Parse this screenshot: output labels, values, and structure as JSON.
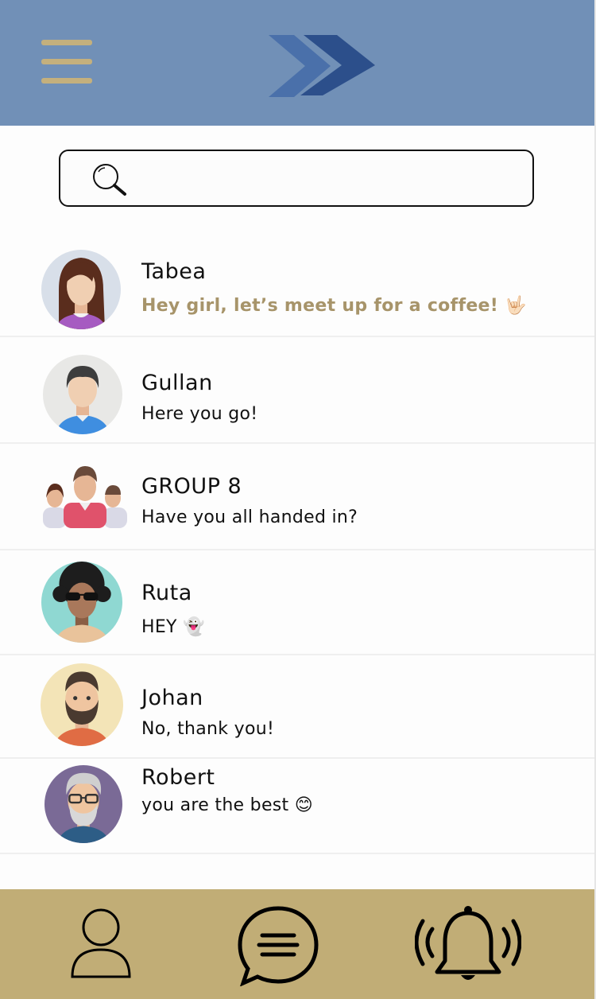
{
  "app": {
    "header_color": "#7190b7",
    "accent_color": "#c1ad76",
    "unread_color": "#a7946a"
  },
  "header": {
    "menu_icon": "hamburger-menu-icon",
    "logo_icon": "double-chevron-logo"
  },
  "search": {
    "icon": "search-icon",
    "value": "",
    "placeholder": ""
  },
  "chats": [
    {
      "name": "Tabea",
      "message": "Hey girl, let’s meet up for a coffee! 🤟🏻",
      "unread": true,
      "avatar": "woman-avatar"
    },
    {
      "name": "Gullan",
      "message": "Here you go!",
      "unread": false,
      "avatar": "man-avatar"
    },
    {
      "name": "GROUP 8",
      "message": "Have you all handed in?",
      "unread": false,
      "avatar": "group-avatar"
    },
    {
      "name": "Ruta",
      "message": "HEY 👻",
      "unread": false,
      "avatar": "curly-hair-sunglasses-avatar"
    },
    {
      "name": "Johan",
      "message": "No, thank you!",
      "unread": false,
      "avatar": "bearded-man-avatar"
    },
    {
      "name": "Robert",
      "message": "you are the best 😊",
      "unread": false,
      "avatar": "old-man-glasses-avatar"
    }
  ],
  "bottom_nav": [
    {
      "icon": "profile-icon"
    },
    {
      "icon": "chat-bubble-icon"
    },
    {
      "icon": "notification-bell-icon"
    }
  ]
}
